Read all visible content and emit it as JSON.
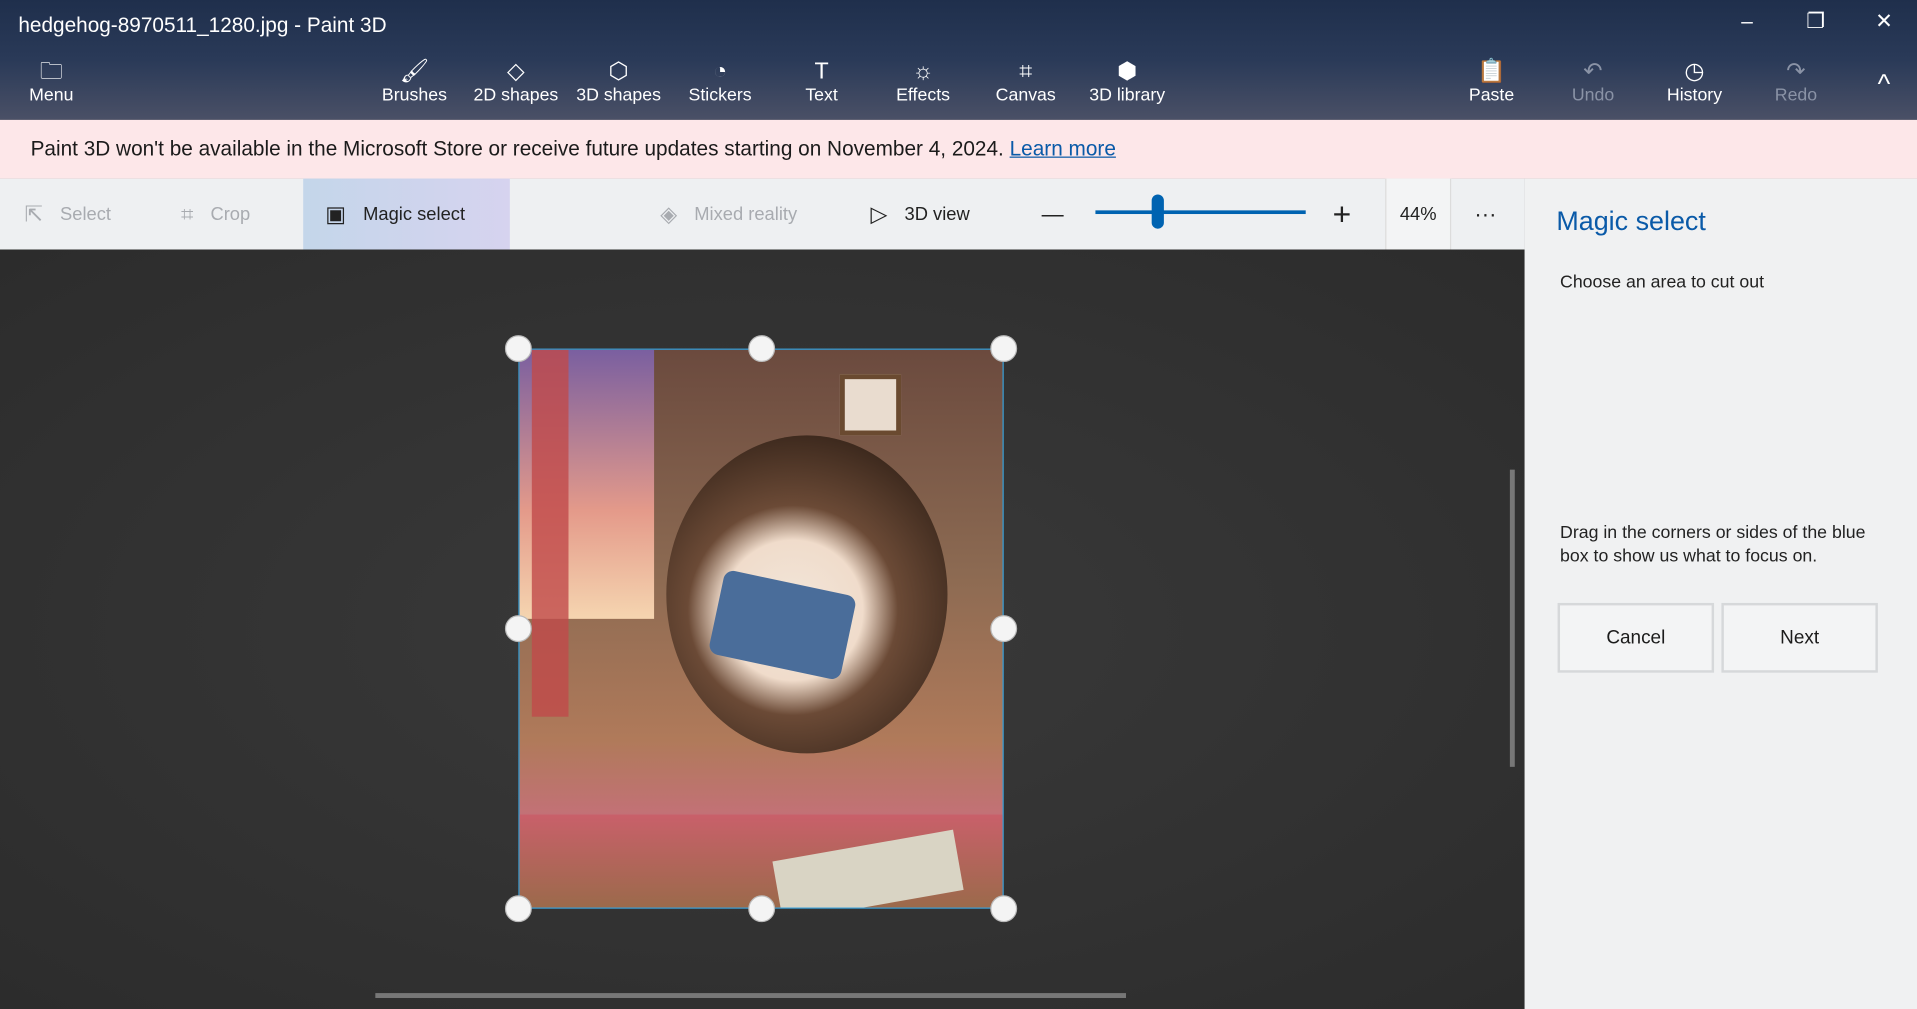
{
  "window": {
    "title": "hedgehog-8970511_1280.jpg - Paint 3D",
    "minimize": "–",
    "restore": "❐",
    "close": "✕"
  },
  "toolbar": {
    "menu": {
      "label": "Menu",
      "icon": "folder-icon"
    },
    "tools": [
      {
        "label": "Brushes",
        "icon": "brush-icon",
        "glyph": "🖌"
      },
      {
        "label": "2D shapes",
        "icon": "2d-shapes-icon",
        "glyph": "◇"
      },
      {
        "label": "3D shapes",
        "icon": "3d-shapes-icon",
        "glyph": "⬡"
      },
      {
        "label": "Stickers",
        "icon": "sticker-icon",
        "glyph": "◔"
      },
      {
        "label": "Text",
        "icon": "text-icon",
        "glyph": "T"
      },
      {
        "label": "Effects",
        "icon": "effects-icon",
        "glyph": "☼"
      },
      {
        "label": "Canvas",
        "icon": "canvas-icon",
        "glyph": "⌗"
      },
      {
        "label": "3D library",
        "icon": "3d-library-icon",
        "glyph": "⬢"
      }
    ],
    "right": [
      {
        "label": "Paste",
        "icon": "paste-icon",
        "glyph": "📋",
        "disabled": false
      },
      {
        "label": "Undo",
        "icon": "undo-icon",
        "glyph": "↶",
        "disabled": true
      },
      {
        "label": "History",
        "icon": "history-icon",
        "glyph": "◷",
        "disabled": false
      },
      {
        "label": "Redo",
        "icon": "redo-icon",
        "glyph": "↷",
        "disabled": true
      }
    ],
    "collapse": "^"
  },
  "banner": {
    "text": "Paint 3D won't be available in the Microsoft Store or receive future updates starting on November 4, 2024.",
    "link": "Learn more"
  },
  "subtoolbar": {
    "select": "Select",
    "crop": "Crop",
    "magic_select": "Magic select",
    "mixed_reality": "Mixed reality",
    "view_3d": "3D view",
    "zoom_out": "—",
    "zoom_in": "+",
    "zoom": "44%",
    "zoom_percent": 44,
    "more": "···"
  },
  "panel": {
    "title": "Magic select",
    "subtitle": "Choose an area to cut out",
    "hint": "Drag in the corners or sides of the blue box to show us what to focus on.",
    "cancel": "Cancel",
    "next": "Next"
  },
  "colors": {
    "accent": "#0063b1",
    "banner": "#fde7e9"
  }
}
